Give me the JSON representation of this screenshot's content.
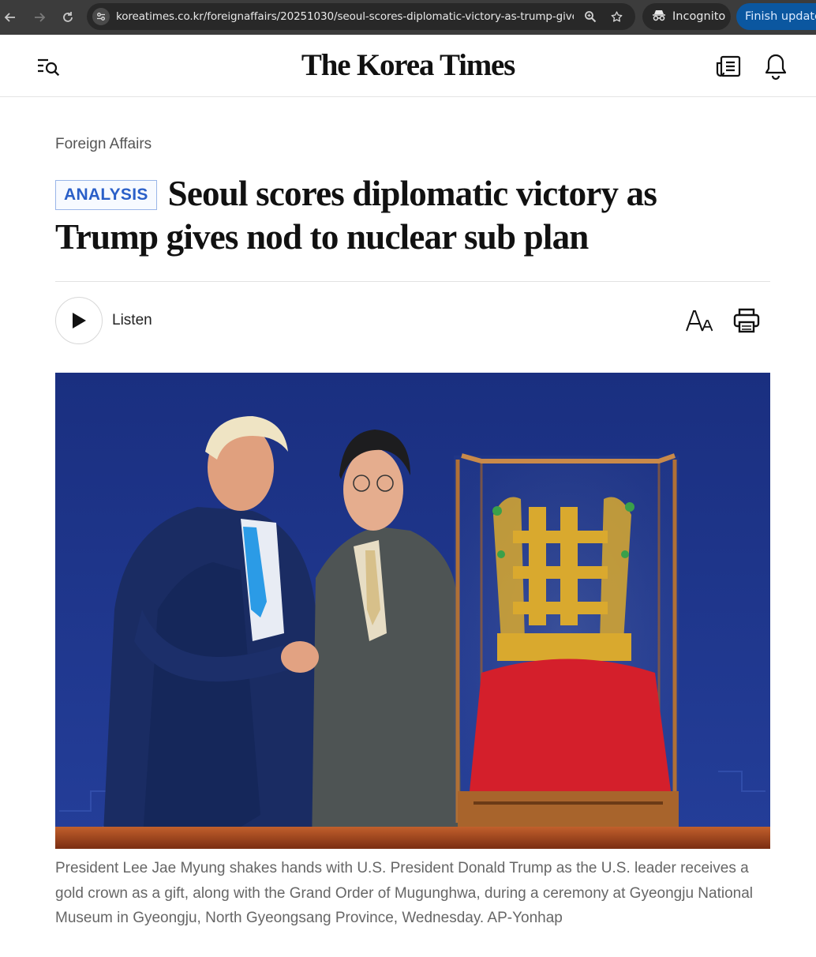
{
  "browser": {
    "url": "koreatimes.co.kr/foreignaffairs/20251030/seoul-scores-diplomatic-victory-as-trump-give...",
    "incognito_label": "Incognito",
    "update_label": "Finish update"
  },
  "site": {
    "logo": "The Korea Times"
  },
  "article": {
    "section": "Foreign Affairs",
    "badge": "ANALYSIS",
    "title": "Seoul scores diplomatic victory as Trump gives nod to nuclear sub plan",
    "listen_label": "Listen",
    "caption": "President Lee Jae Myung shakes hands with U.S. President Donald Trump as the U.S. leader receives a gold crown as a gift, along with the Grand Order of Mugunghwa, during a ceremony at Gyeongju National Museum in Gyeongju, North Gyeongsang Province, Wednesday. AP-Yonhap"
  },
  "icons": [
    "back-arrow-icon",
    "forward-arrow-icon",
    "reload-icon",
    "site-info-icon",
    "zoom-icon",
    "bookmark-star-icon",
    "incognito-icon",
    "menu-search-icon",
    "newspaper-icon",
    "bell-icon",
    "play-icon",
    "font-size-icon",
    "print-icon"
  ],
  "colors": {
    "badge_text": "#2a5fc8",
    "photo_background": "#1f3a8a",
    "crown_cushion": "#d41f2b",
    "update_button": "#0b57a0"
  }
}
